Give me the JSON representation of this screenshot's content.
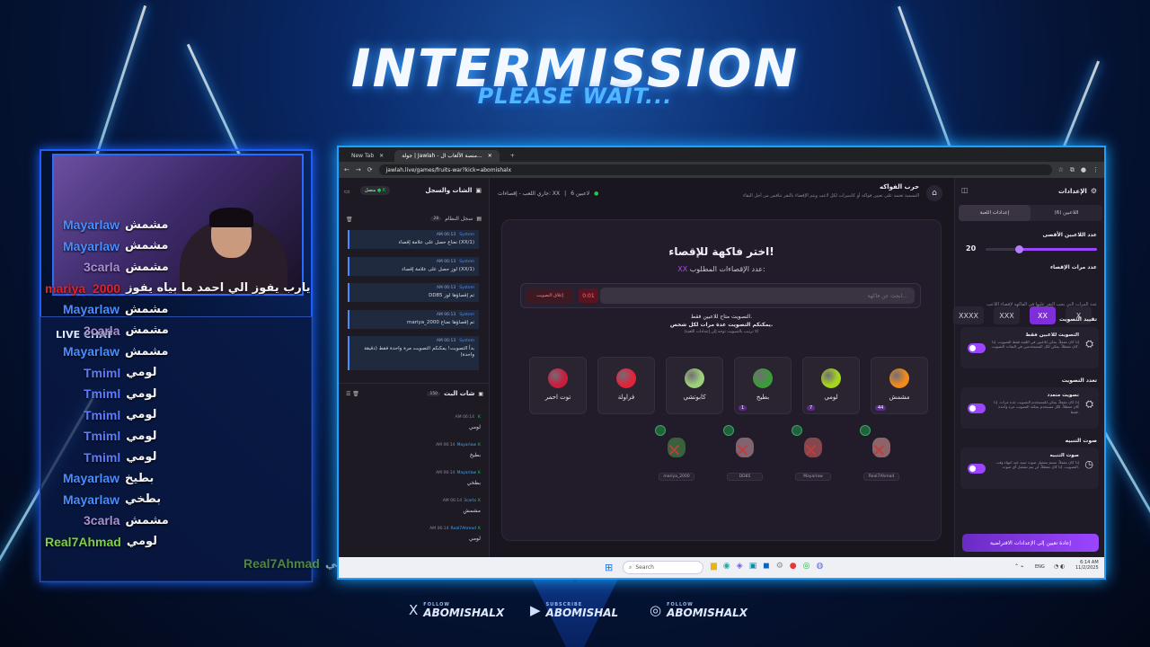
{
  "overlay": {
    "title": "INTERMISSION",
    "subtitle": "PLEASE WAIT...",
    "live_label": "LIVE CHAT"
  },
  "stream_chat": [
    {
      "name": "Mayarlaw",
      "msg": "مشمش",
      "color": "#4a8dff"
    },
    {
      "name": "Mayarlaw",
      "msg": "مشمش",
      "color": "#4a8dff"
    },
    {
      "name": "3carla",
      "msg": "مشمش",
      "color": "#a98fd6"
    },
    {
      "name": "mariya_2000",
      "msg": "يارب يفوز الي احمد ما بياه يفوز",
      "color": "#e0242a"
    },
    {
      "name": "Mayarlaw",
      "msg": "مشمش",
      "color": "#4a8dff"
    },
    {
      "name": "3carla",
      "msg": "مشمش",
      "color": "#a98fd6"
    },
    {
      "name": "Mayarlaw",
      "msg": "مشمش",
      "color": "#4a8dff"
    },
    {
      "name": "Tmiml",
      "msg": "لومي",
      "color": "#5b7cff"
    },
    {
      "name": "Tmiml",
      "msg": "لومي",
      "color": "#5b7cff"
    },
    {
      "name": "Tmiml",
      "msg": "لومي",
      "color": "#5b7cff"
    },
    {
      "name": "Tmiml",
      "msg": "لومي",
      "color": "#5b7cff"
    },
    {
      "name": "Tmiml",
      "msg": "لومي",
      "color": "#5b7cff"
    },
    {
      "name": "Mayarlaw",
      "msg": "بطيخ",
      "color": "#4a8dff"
    },
    {
      "name": "Mayarlaw",
      "msg": "بطخي",
      "color": "#4a8dff"
    },
    {
      "name": "3carla",
      "msg": "مشمش",
      "color": "#a98fd6"
    },
    {
      "name": "Real7Ahmad",
      "msg": "لومي",
      "color": "#7dd33f"
    },
    {
      "name": "Real7Ahmad",
      "msg": "لومي",
      "color": "#7dd33f"
    }
  ],
  "browser": {
    "tabs": [
      "New Tab",
      "جولة | Jawlah - منصة الألعاب ال..."
    ],
    "url": "jawlah.live/games/fruits-war?kick=abomishalx"
  },
  "left_panel": {
    "title": "الشات والسجل",
    "connected": "متصل",
    "system_log_title": "سجل النظام",
    "system_log_count": "28",
    "logs": [
      {
        "time": "AM 06:13",
        "tag": "System",
        "text": "نعناع حصل على علامة إقصاء (XX/1)"
      },
      {
        "time": "AM 06:13",
        "tag": "System",
        "text": "لوز حصل على علامة إقصاء (XX/1)"
      },
      {
        "time": "AM 06:13",
        "tag": "System",
        "text": "DD85 تم إقصاؤها لوز"
      },
      {
        "time": "AM 06:13",
        "tag": "System",
        "text": "mariya_2000 تم إقصاؤها نعناع"
      },
      {
        "time": "AM 06:13",
        "tag": "System",
        "text": "بدأ التصويت! يمكنكم التصويت مرة واحدة فقط (دقيقة واحدة)"
      }
    ],
    "live_chat_title": "شات البث",
    "live_chat_count": "150",
    "messages": [
      {
        "time": "AM 06:14",
        "user": "",
        "text": "لومي"
      },
      {
        "time": "AM 06:14",
        "user": "Mayarlaw",
        "text": "بطيخ"
      },
      {
        "time": "AM 06:14",
        "user": "Mayarlaw",
        "text": "بطخي"
      },
      {
        "time": "AM 06:14",
        "user": "3carla",
        "text": "مشمش"
      },
      {
        "time": "AM 06:14",
        "user": "Real7Ahmad",
        "text": "لومي"
      }
    ]
  },
  "game": {
    "title": "حرب الفواكه",
    "desc": "التسمية تعتمد على تعيين فواكه أو كاسيرات لكل لاعب ويتم الإقصاء بالنقر تنافس من أجل البقاء",
    "players": "6 لاعبين",
    "status": "جاري اللعب - إقصاءات: XX",
    "heading": "اختر فاكهة للإقصاء!",
    "required_label": "عدد الإقصاءات المطلوب:",
    "required_value": "XX",
    "search_placeholder": "ابحث عن فاكهة...",
    "timer": "0:01",
    "close_vote": "إغلاق التصويت",
    "vote_note1": "التصويت متاح للاعبين فقط.",
    "vote_note2": "يمكنكم التصويت عدة مرات لكل شخص.",
    "vote_note3": "(لا ترتيب بالتصويت توجه إلى إعدادات اللعبة)",
    "fruits": [
      {
        "name": "مشمش",
        "badge": "44",
        "color": "#f08a1c"
      },
      {
        "name": "لومي",
        "badge": "7",
        "color": "#a5d61f"
      },
      {
        "name": "بطيخ",
        "badge": "1",
        "color": "#3c9b3a"
      },
      {
        "name": "كابوتشي",
        "badge": "",
        "color": "#9ed07a"
      },
      {
        "name": "فراولة",
        "badge": "",
        "color": "#e2233a"
      },
      {
        "name": "توت احمر",
        "badge": "",
        "color": "#c81d3c"
      }
    ],
    "eliminated": [
      {
        "name": "Real7Ahmad",
        "color": "#e8a0a0"
      },
      {
        "name": "Mayarlaw",
        "color": "#d86a6a"
      },
      {
        "name": "DD85",
        "color": "#d0a0a8"
      },
      {
        "name": "mariya_2000",
        "color": "#4a9a4a"
      }
    ]
  },
  "settings": {
    "title": "الإعدادات",
    "tab_players": "اللاعبين (6)",
    "tab_game": "إعدادات اللعبة",
    "max_players_label": "عدد اللاعبين الأقصى",
    "max_players_value": "20",
    "max_players_fraction": 0.3,
    "elim_label": "عدد مرات الإقصاء",
    "elim_options": [
      "X",
      "XX",
      "XXX",
      "XXXX"
    ],
    "elim_selected": "XX",
    "elim_note": "عدد المرات التي يجب النقر عليها في الفاكهة لإقصاء اللاعب",
    "restrict_label": "تقييد التصويت",
    "restrict_title": "التصويت للاعبين فقط",
    "restrict_desc": "إذا كان مفعلاً، يمكن للاعبين في اللعبة فقط التصويت. إذا كان معطلاً، يمكن لكل المستخدمين في الشات التصويت.",
    "multi_label": "تعدد التصويت",
    "multi_title": "تصويت متعدد",
    "multi_desc": "إذا كان مفعلاً، يمكن للمستخدم التصويت عدة مرات. إذا كان معطلاً، لكل مستخدم يمكنه التصويت مرة واحدة فقط.",
    "sound_label": "صوت التنبيه",
    "sound_title": "صوت التنبيه",
    "sound_desc": "إذا كان مفعلاً، سيتم تشغيل صوت تنبيه عند انتهاء وقت التصويت. إذا كان معطلاً، لن يتم تشغيل أي صوت.",
    "reset": "إعادة تعيين إلى الإعدادات الافتراضية"
  },
  "taskbar": {
    "search": "Search",
    "lang": "ENG",
    "time": "6:14 AM",
    "date": "11/2/2025"
  },
  "socials": [
    {
      "small": "FOLLOW",
      "name": "ABOMISHALX",
      "icon": "X"
    },
    {
      "small": "SUBSCRIBE",
      "name": "ABOMISHAL",
      "icon": "▶"
    },
    {
      "small": "FOLLOW",
      "name": "ABOMISHALX",
      "icon": "◎"
    }
  ]
}
